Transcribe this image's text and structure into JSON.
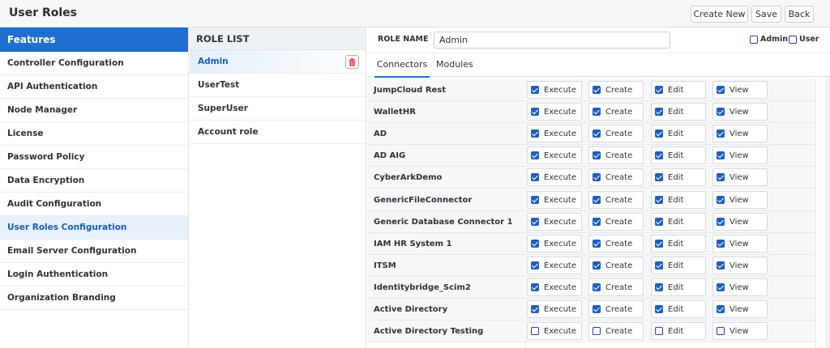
{
  "header": {
    "title": "User Roles",
    "buttons": {
      "create_new": "Create New",
      "save": "Save",
      "back": "Back"
    }
  },
  "sidebar": {
    "heading": "Features",
    "items": [
      {
        "label": "Controller Configuration"
      },
      {
        "label": "API Authentication"
      },
      {
        "label": "Node Manager"
      },
      {
        "label": "License"
      },
      {
        "label": "Password Policy"
      },
      {
        "label": "Data Encryption"
      },
      {
        "label": "Audit Configuration"
      },
      {
        "label": "User Roles Configuration",
        "active": true
      },
      {
        "label": "Email Server Configuration"
      },
      {
        "label": "Login Authentication"
      },
      {
        "label": "Organization Branding"
      }
    ]
  },
  "role_list": {
    "heading": "ROLE LIST",
    "items": [
      {
        "label": "Admin",
        "active": true
      },
      {
        "label": "UserTest"
      },
      {
        "label": "SuperUser"
      },
      {
        "label": "Account role"
      }
    ]
  },
  "role_form": {
    "label": "ROLE NAME",
    "value": "Admin",
    "admin_checkbox": "Admin",
    "user_checkbox": "User"
  },
  "tabs": [
    {
      "label": "Connectors",
      "active": true
    },
    {
      "label": "Modules"
    }
  ],
  "permission_labels": [
    "Execute",
    "Create",
    "Edit",
    "View"
  ],
  "connectors": [
    {
      "name": "JumpCloud Rest",
      "checked": [
        true,
        true,
        true,
        true
      ]
    },
    {
      "name": "WalletHR",
      "checked": [
        true,
        true,
        true,
        true
      ]
    },
    {
      "name": "AD",
      "checked": [
        true,
        true,
        true,
        true
      ]
    },
    {
      "name": "AD AIG",
      "checked": [
        true,
        true,
        true,
        true
      ]
    },
    {
      "name": "CyberArkDemo",
      "checked": [
        true,
        true,
        true,
        true
      ]
    },
    {
      "name": "GenericFileConnector",
      "checked": [
        true,
        true,
        true,
        true
      ]
    },
    {
      "name": "Generic Database Connector 1",
      "checked": [
        true,
        true,
        true,
        true
      ]
    },
    {
      "name": "IAM HR System 1",
      "checked": [
        true,
        true,
        true,
        true
      ]
    },
    {
      "name": "ITSM",
      "checked": [
        true,
        true,
        true,
        true
      ]
    },
    {
      "name": "Identitybridge_Scim2",
      "checked": [
        true,
        true,
        true,
        true
      ]
    },
    {
      "name": "Active Directory",
      "checked": [
        true,
        true,
        true,
        true
      ]
    },
    {
      "name": "Active Directory Testing",
      "checked": [
        false,
        false,
        false,
        false
      ]
    }
  ],
  "colors": {
    "accent": "#1f6fd0",
    "checkbox": "#1f5fbf",
    "delete": "#d9363e"
  }
}
